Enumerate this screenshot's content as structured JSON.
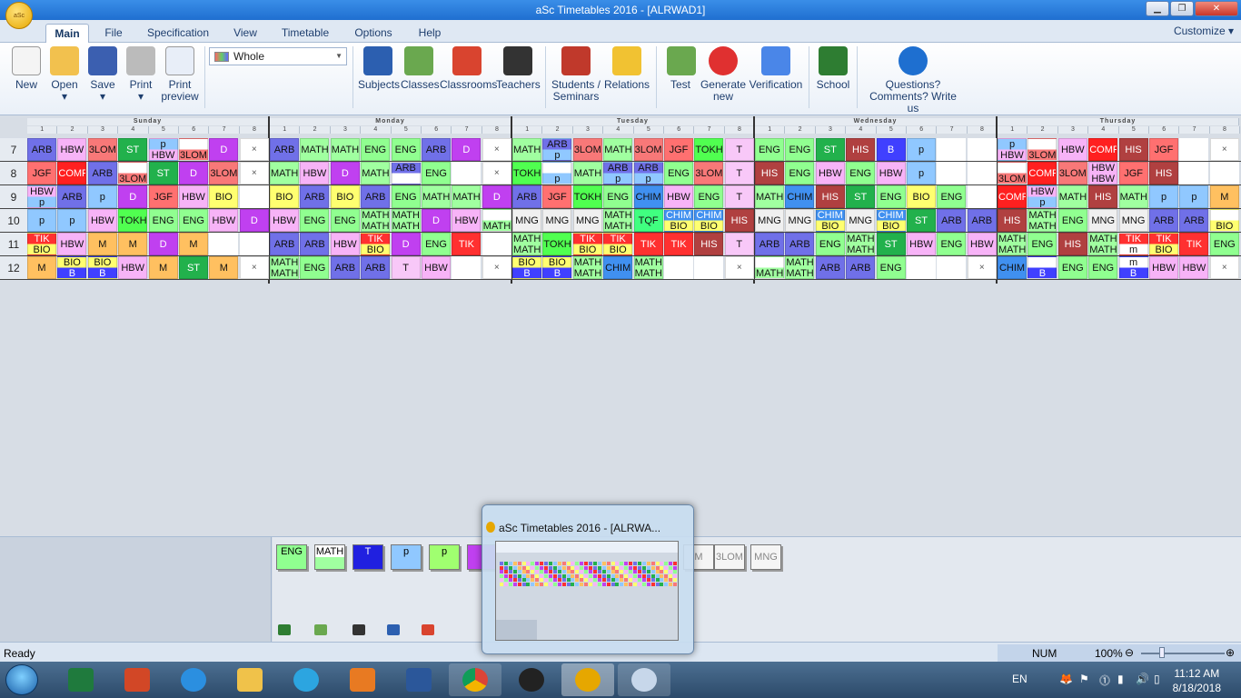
{
  "window": {
    "title": "aSc Timetables 2016  - [ALRWAD1]",
    "app_icon_text": "aSc"
  },
  "menu": {
    "tabs": [
      "Main",
      "File",
      "Specification",
      "View",
      "Timetable",
      "Options",
      "Help"
    ],
    "active": "Main",
    "customize": "Customize ▾"
  },
  "ribbon": {
    "new": "New",
    "open": "Open",
    "save": "Save",
    "print": "Print",
    "print_preview_1": "Print",
    "print_preview_2": "preview",
    "view_combo": "Whole",
    "subjects": "Subjects",
    "classes": "Classes",
    "classrooms": "Classrooms",
    "teachers": "Teachers",
    "students_1": "Students /",
    "students_2": "Seminars",
    "relations": "Relations",
    "test": "Test",
    "generate_1": "Generate",
    "generate_2": "new",
    "verification": "Verification",
    "school": "School",
    "questions_1": "Questions?",
    "questions_2": "Comments? Write us"
  },
  "days": [
    "Sunday",
    "Monday",
    "Tuesday",
    "Wednesday",
    "Thursday"
  ],
  "periods": [
    "1",
    "2",
    "3",
    "4",
    "5",
    "6",
    "7",
    "8"
  ],
  "row_labels": [
    "7",
    "8",
    "9",
    "10",
    "11",
    "12"
  ],
  "colors": {
    "ARB": "#7070e8",
    "HBW": "#f7b3f7",
    "3LOM": "#f87878",
    "ST": "#22b14c",
    "D": "#c040f0",
    "JGF": "#ff7070",
    "COMP": "#ff2020",
    "BIO": "#ffff70",
    "p": "#90c8ff",
    "TOKH": "#50ff50",
    "ENG": "#90ff90",
    "MATH": "#a0ffa0",
    "M": "#ffc060",
    "B": "#4040ff",
    "T": "#f8c8f8",
    "TIK": "#ff3030",
    "HIS": "#b04040",
    "CHIM": "#4090f0",
    "MNG": "#f0f0f0",
    "TQF": "#40ff80",
    "x": "#ffffff",
    "": "#ffffff"
  },
  "timetable": [
    [
      [
        "ARB",
        "HBW",
        "3LOM",
        "ST",
        "p|HBW",
        "|3LOM",
        "D",
        "x"
      ],
      [
        "ARB",
        "MATH",
        "MATH",
        "ENG",
        "ENG",
        "ARB",
        "D",
        "x"
      ],
      [
        "MATH",
        "ARB|p",
        "3LOM",
        "MATH",
        "3LOM",
        "JGF",
        "TOKH",
        "T"
      ],
      [
        "ENG",
        "ENG",
        "ST",
        "HIS",
        "B",
        "p",
        "",
        ""
      ],
      [
        "p|HBW",
        "|3LOM",
        "HBW",
        "COMP",
        "HIS",
        "JGF",
        "",
        "x"
      ]
    ],
    [
      [
        "JGF",
        "COMP",
        "ARB",
        "|3LOM",
        "ST",
        "D",
        "3LOM",
        "x"
      ],
      [
        "MATH",
        "HBW",
        "D",
        "MATH",
        "ARB|",
        "ENG",
        "",
        "x"
      ],
      [
        "TOKH",
        "|p",
        "MATH",
        "ARB|p",
        "ARB|p",
        "ENG",
        "3LOM",
        "T"
      ],
      [
        "HIS",
        "ENG",
        "HBW",
        "ENG",
        "HBW",
        "p",
        "",
        ""
      ],
      [
        "|3LOM",
        "COMP",
        "3LOM",
        "HBW|HBW",
        "JGF",
        "HIS",
        "",
        ""
      ]
    ],
    [
      [
        "HBW|p",
        "ARB",
        "p",
        "D",
        "JGF",
        "HBW",
        "BIO",
        ""
      ],
      [
        "BIO",
        "ARB",
        "BIO",
        "ARB",
        "ENG",
        "MATH",
        "MATH",
        "D"
      ],
      [
        "ARB",
        "JGF",
        "TOKH",
        "ENG",
        "CHIM",
        "HBW",
        "ENG",
        "T"
      ],
      [
        "MATH",
        "CHIM",
        "HIS",
        "ST",
        "ENG",
        "BIO",
        "ENG",
        ""
      ],
      [
        "COMP",
        "HBW|p",
        "MATH",
        "HIS",
        "MATH",
        "p",
        "p",
        "M"
      ]
    ],
    [
      [
        "p",
        "p",
        "HBW",
        "TOKH",
        "ENG",
        "ENG",
        "HBW",
        "D"
      ],
      [
        "HBW",
        "ENG",
        "ENG",
        "MATH|MATH",
        "MATH|MATH",
        "D",
        "HBW",
        "|MATH"
      ],
      [
        "MNG",
        "MNG",
        "MNG",
        "MATH|MATH",
        "TQF",
        "CHIM|BIO",
        "CHIM|BIO",
        "HIS"
      ],
      [
        "MNG",
        "MNG",
        "CHIM|BIO",
        "MNG",
        "CHIM|BIO",
        "ST",
        "ARB",
        "ARB"
      ],
      [
        "HIS",
        "MATH|MATH",
        "ENG",
        "MNG",
        "MNG",
        "ARB",
        "ARB",
        "|BIO"
      ]
    ],
    [
      [
        "TIK|BIO",
        "HBW",
        "M",
        "M",
        "D",
        "M",
        "",
        ""
      ],
      [
        "ARB",
        "ARB",
        "HBW",
        "TIK|BIO",
        "D",
        "ENG",
        "TIK",
        ""
      ],
      [
        "MATH|MATH",
        "TOKH",
        "TIK|BIO",
        "TIK|BIO",
        "TIK",
        "TIK",
        "HIS",
        "T"
      ],
      [
        "ARB",
        "ARB",
        "ENG",
        "MATH|MATH",
        "ST",
        "HBW",
        "ENG",
        "HBW"
      ],
      [
        "MATH|MATH",
        "ENG",
        "HIS",
        "MATH|MATH",
        "TIK|m",
        "TIK|BIO",
        "TIK",
        "ENG"
      ]
    ],
    [
      [
        "M",
        "BIO|B",
        "BIO|B",
        "HBW",
        "M",
        "ST",
        "M",
        "x"
      ],
      [
        "MATH|MATH",
        "ENG",
        "ARB",
        "ARB",
        "T",
        "HBW",
        "",
        "x"
      ],
      [
        "BIO|B",
        "BIO|B",
        "MATH|MATH",
        "CHIM",
        "MATH|MATH",
        "",
        "",
        "x"
      ],
      [
        "|MATH",
        "MATH|MATH",
        "ARB",
        "ARB",
        "ENG",
        "",
        "",
        "x"
      ],
      [
        "CHIM",
        "|B",
        "ENG",
        "ENG",
        "m|B",
        "HBW",
        "HBW",
        "x"
      ]
    ]
  ],
  "unplaced_cards": [
    {
      "a": "ENG",
      "b": ""
    },
    {
      "a": "",
      "b": "MATH"
    },
    {
      "a": "T",
      "b": ""
    },
    {
      "a": "p",
      "b": ""
    },
    {
      "a": "p",
      "b": ""
    },
    {
      "a": "",
      "b": ""
    }
  ],
  "unplaced_right": [
    "M",
    "3LOM",
    "MNG"
  ],
  "thumbnail": {
    "title": "aSc Timetables 2016  - [ALRWA..."
  },
  "status": {
    "ready": "Ready",
    "num": "NUM",
    "zoom": "100%"
  },
  "tray": {
    "lang": "EN",
    "time": "11:12 AM",
    "date": "8/18/2018"
  }
}
